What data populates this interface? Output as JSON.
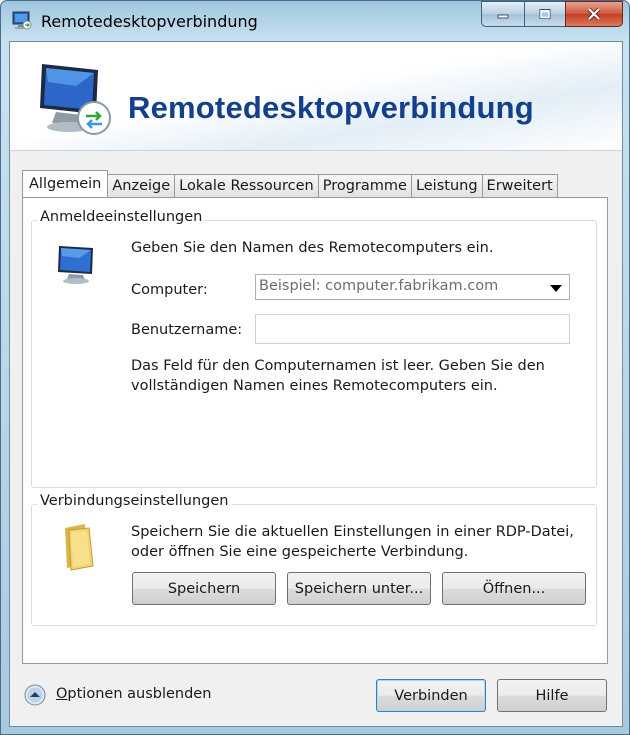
{
  "window": {
    "title": "Remotedesktopverbindung",
    "accent": "#143f8a"
  },
  "banner": {
    "title": "Remotedesktopverbindung"
  },
  "tabs": [
    {
      "label": "Allgemein",
      "active": true
    },
    {
      "label": "Anzeige",
      "active": false
    },
    {
      "label": "Lokale Ressourcen",
      "active": false
    },
    {
      "label": "Programme",
      "active": false
    },
    {
      "label": "Leistung",
      "active": false
    },
    {
      "label": "Erweitert",
      "active": false
    }
  ],
  "logon": {
    "group_label": "Anmeldeeinstellungen",
    "instruction": "Geben Sie den Namen des Remotecomputers ein.",
    "computer_label": "Computer:",
    "computer_placeholder": "Beispiel: computer.fabrikam.com",
    "username_label": "Benutzername:",
    "username_value": "",
    "warning_line1": "Das Feld für den Computernamen ist leer. Geben Sie den",
    "warning_line2": "vollständigen Namen eines Remotecomputers ein."
  },
  "connection": {
    "group_label": "Verbindungseinstellungen",
    "desc_line1": "Speichern Sie die aktuellen Einstellungen in einer RDP-Datei,",
    "desc_line2": "oder öffnen Sie eine gespeicherte Verbindung.",
    "save_label": "Speichern",
    "save_as_label": "Speichern unter...",
    "open_label": "Öffnen..."
  },
  "footer": {
    "options_first_letter": "O",
    "options_rest": "ptionen ausblenden",
    "connect_label": "Verbinden",
    "help_label": "Hilfe"
  },
  "icons": [
    "rdp-app-icon",
    "minimize-icon",
    "maximize-icon",
    "close-icon",
    "monitor-icon",
    "folder-icon",
    "chevron-up-icon"
  ]
}
